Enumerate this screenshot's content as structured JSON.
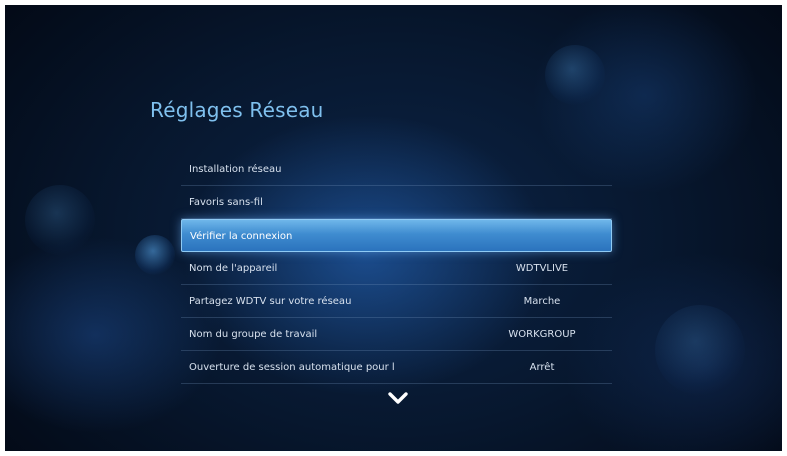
{
  "page": {
    "title": "Réglages Réseau"
  },
  "menu": {
    "items": [
      {
        "label": "Installation réseau",
        "value": ""
      },
      {
        "label": "Favoris sans-fil",
        "value": ""
      },
      {
        "label": "Vérifier la connexion",
        "value": "",
        "selected": true
      },
      {
        "label": "Nom de l'appareil",
        "value": "WDTVLIVE"
      },
      {
        "label": "Partagez WDTV sur votre réseau",
        "value": "Marche"
      },
      {
        "label": "Nom du groupe de travail",
        "value": "WORKGROUP"
      },
      {
        "label": "Ouverture de session automatique pour l",
        "value": "Arrêt"
      }
    ]
  },
  "icons": {
    "scroll_down": "chevron-down-icon"
  },
  "colors": {
    "title": "#7fc0ee",
    "highlight": "#3f8cd0",
    "text": "#d7e1ee",
    "background": "#07172e"
  }
}
